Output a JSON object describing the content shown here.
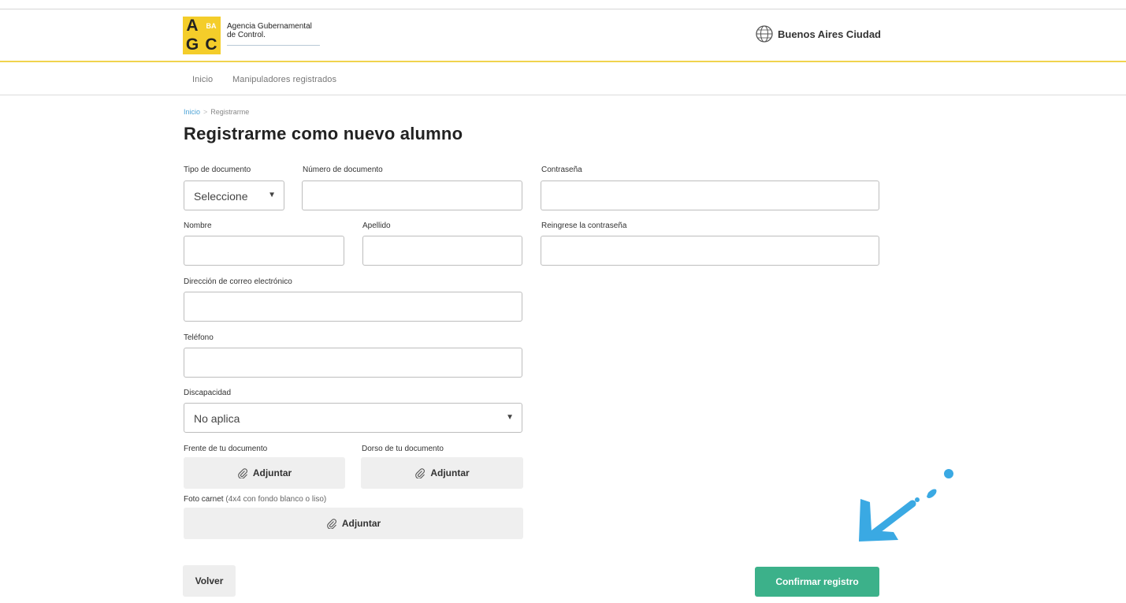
{
  "brand": {
    "logo_letters": [
      "A",
      "BA",
      "G",
      "C"
    ],
    "agency_line1": "Agencia Gubernamental",
    "agency_line2": "de Control.",
    "city_brand": "Buenos Aires Ciudad",
    "accent_color": "#f0d34e"
  },
  "nav": {
    "items": [
      "Inicio",
      "Manipuladores registrados"
    ]
  },
  "breadcrumb": {
    "home": "Inicio",
    "separator": ">",
    "current": "Registrarme"
  },
  "page": {
    "title": "Registrarme como nuevo alumno"
  },
  "form": {
    "tipo_documento_label": "Tipo de documento",
    "tipo_documento_value": "Seleccione",
    "numero_documento_label": "Número de documento",
    "contrasena_label": "Contraseña",
    "nombre_label": "Nombre",
    "apellido_label": "Apellido",
    "reingrese_label": "Reingrese la contraseña",
    "email_label": "Dirección de correo electrónico",
    "telefono_label": "Teléfono",
    "discapacidad_label": "Discapacidad",
    "discapacidad_value": "No aplica",
    "frente_label": "Frente de tu documento",
    "dorso_label": "Dorso de tu documento",
    "foto_label_main": "Foto carnet",
    "foto_label_hint": "(4x4 con fondo blanco o liso)",
    "attach_label": "Adjuntar"
  },
  "actions": {
    "back_label": "Volver",
    "confirm_label": "Confirmar registro",
    "confirm_color": "#3cb18a",
    "annotation_arrow_color": "#3aa9e3"
  }
}
